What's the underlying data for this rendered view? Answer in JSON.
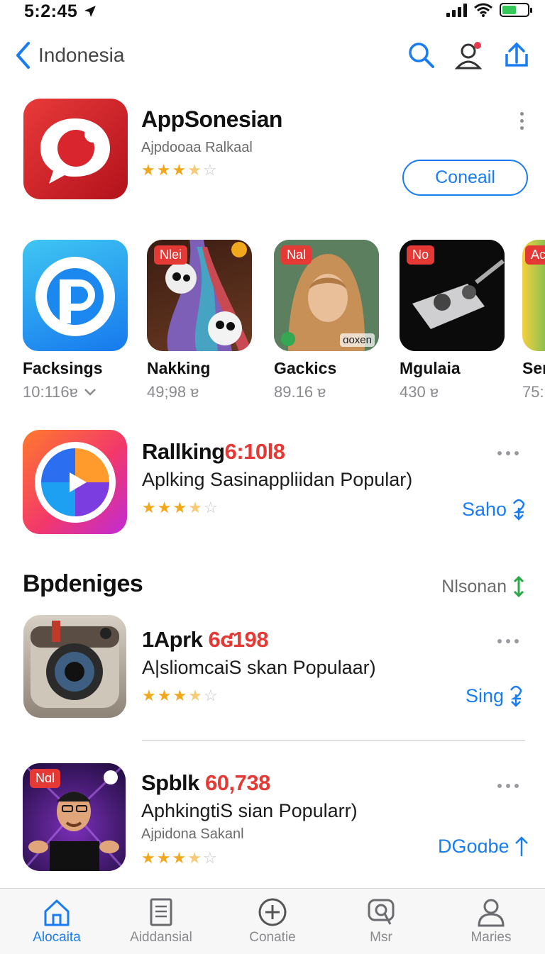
{
  "status_bar": {
    "time": "5:2:45"
  },
  "nav": {
    "back_label": "Indonesia"
  },
  "featured": {
    "title": "AppSonesian",
    "subtitle": "Ajpdooaa Ralkaal",
    "rating": 3.5,
    "button_label": "Coneail"
  },
  "carousel": [
    {
      "name": "Facksings",
      "meta": "10:116ɐ",
      "badge": ""
    },
    {
      "name": "Nakking",
      "meta": "49;98 ɐ",
      "badge": "Nlei"
    },
    {
      "name": "Gackics",
      "meta": "89.16 ɐ",
      "badge": "Nal",
      "watermark": "ɑoxen"
    },
    {
      "name": "Mgulaia",
      "meta": "430 ɐ",
      "badge": "No"
    },
    {
      "name": "Ser",
      "meta": "75:",
      "badge": "Ac"
    }
  ],
  "ranking_row": {
    "title_main": "Rallking",
    "title_num": "6:10l8",
    "subtitle": "Aplking Sasinappliidan Popular)",
    "rating": 3.5,
    "action_label": "Saho"
  },
  "section": {
    "title": "Bpdeniges",
    "link_label": "Nlsonan"
  },
  "list": [
    {
      "title_main": "1Aprk",
      "title_num": "6ʛ198",
      "subtitle": "A|sliomcaiS skan Populaar)",
      "caption": "",
      "rating": 3.5,
      "action_label": "Sing"
    },
    {
      "title_main": "Spblk",
      "title_num": "60,738",
      "subtitle": "AphkingtiS sian Popularr)",
      "caption": "Ajpidona Sakanl",
      "rating": 3.5,
      "action_label": "DGoɑbe",
      "badge": "Nɑl"
    }
  ],
  "tabs": [
    {
      "label": "Alocaita",
      "icon": "house-icon",
      "active": true
    },
    {
      "label": "Aiddansial",
      "icon": "document-icon",
      "active": false
    },
    {
      "label": "Conatie",
      "icon": "plus-circle-icon",
      "active": false
    },
    {
      "label": "Msr",
      "icon": "search-bubble-icon",
      "active": false
    },
    {
      "label": "Maries",
      "icon": "person-icon",
      "active": false
    }
  ],
  "colors": {
    "accent": "#1a7cf3",
    "star": "#f2a81d",
    "red": "#e53935"
  }
}
